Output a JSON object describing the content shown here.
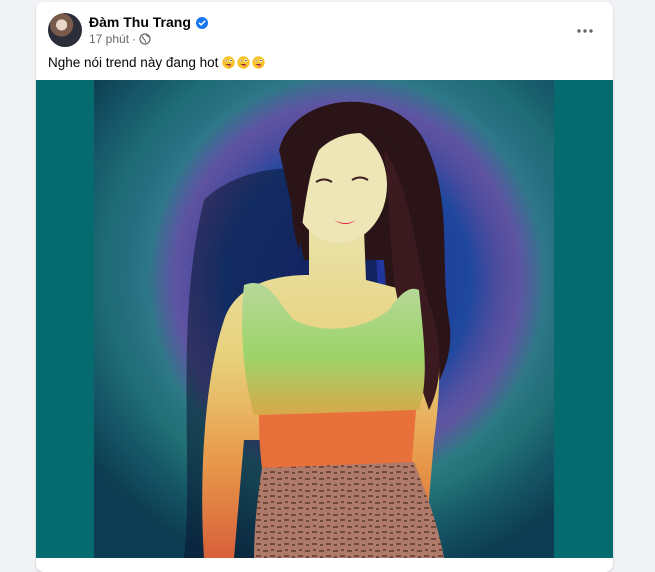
{
  "post": {
    "author": {
      "name": "Đàm Thu Trang",
      "verified": true
    },
    "meta": {
      "time": "17 phút",
      "separator": "·",
      "audience_icon": "globe-icon"
    },
    "more_icon": "more-horizontal-icon",
    "text": "Nghe nói trend này đang hot",
    "emojis": [
      "zany-face-emoji",
      "zany-face-emoji",
      "zany-face-emoji"
    ],
    "media": {
      "type": "photo",
      "background_color": "#056b6e"
    }
  },
  "colors": {
    "text_primary": "#050505",
    "text_secondary": "#65676b",
    "verified_blue": "#1877f2",
    "page_background": "#f0f2f5"
  }
}
